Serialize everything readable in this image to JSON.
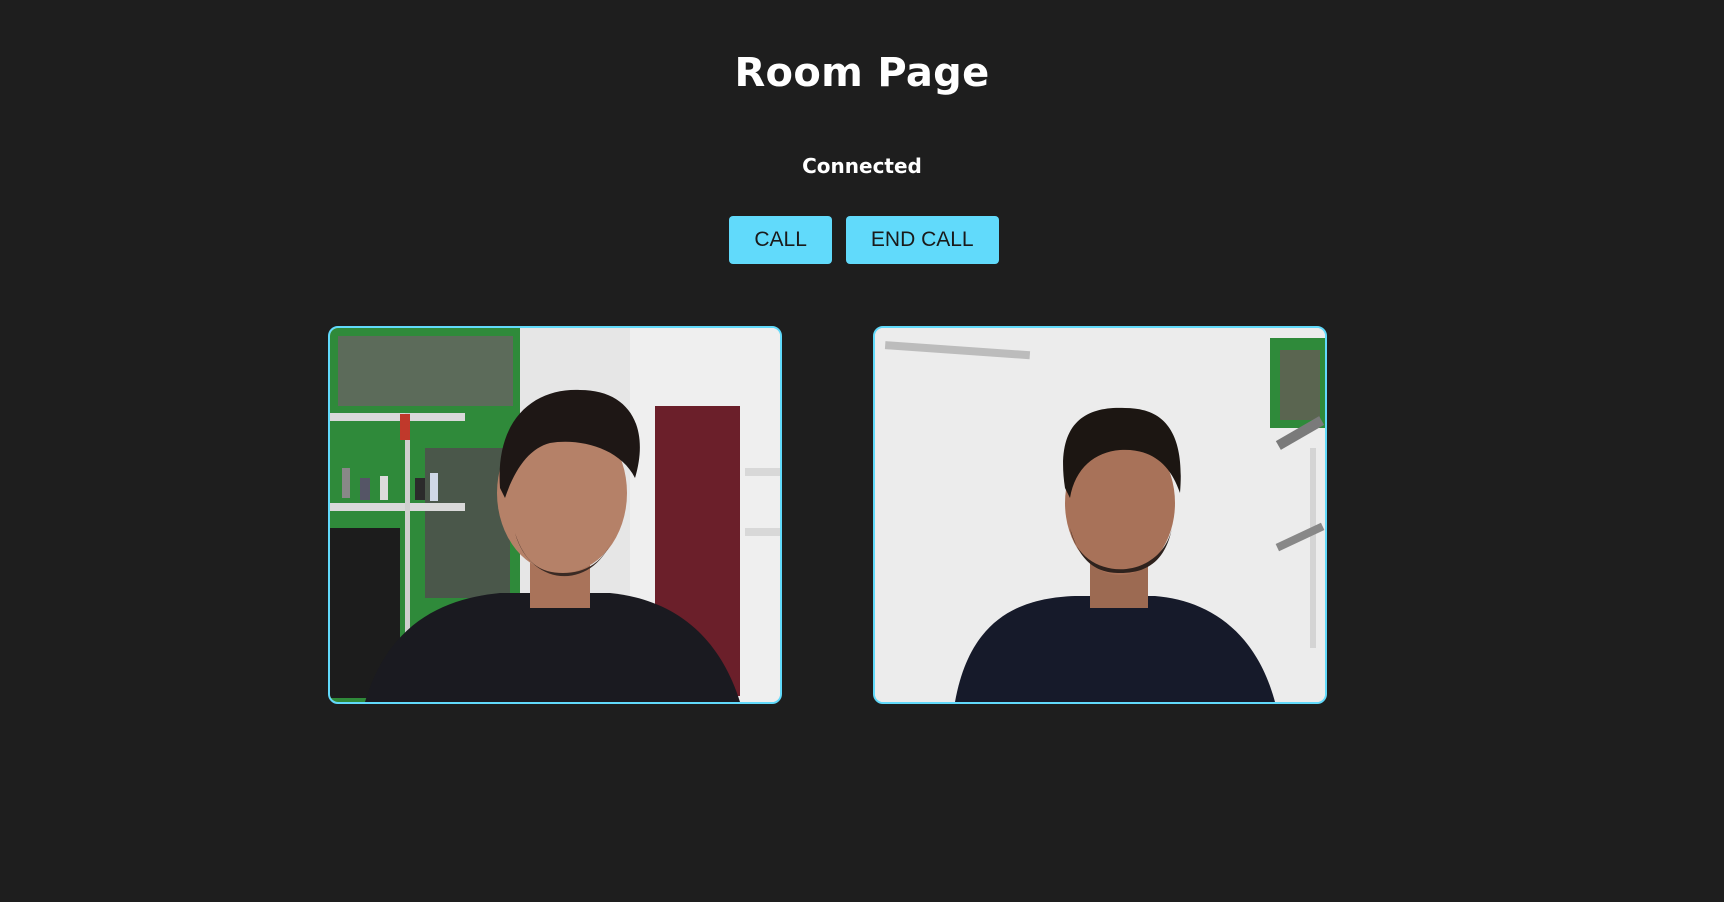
{
  "page": {
    "title": "Room Page",
    "status": "Connected"
  },
  "controls": {
    "call_label": "CALL",
    "end_call_label": "END CALL"
  },
  "videos": {
    "local": {
      "icon": "video-feed-local"
    },
    "remote": {
      "icon": "video-feed-remote"
    }
  },
  "colors": {
    "background": "#1e1e1e",
    "accent": "#61dafb",
    "text": "#ffffff"
  }
}
